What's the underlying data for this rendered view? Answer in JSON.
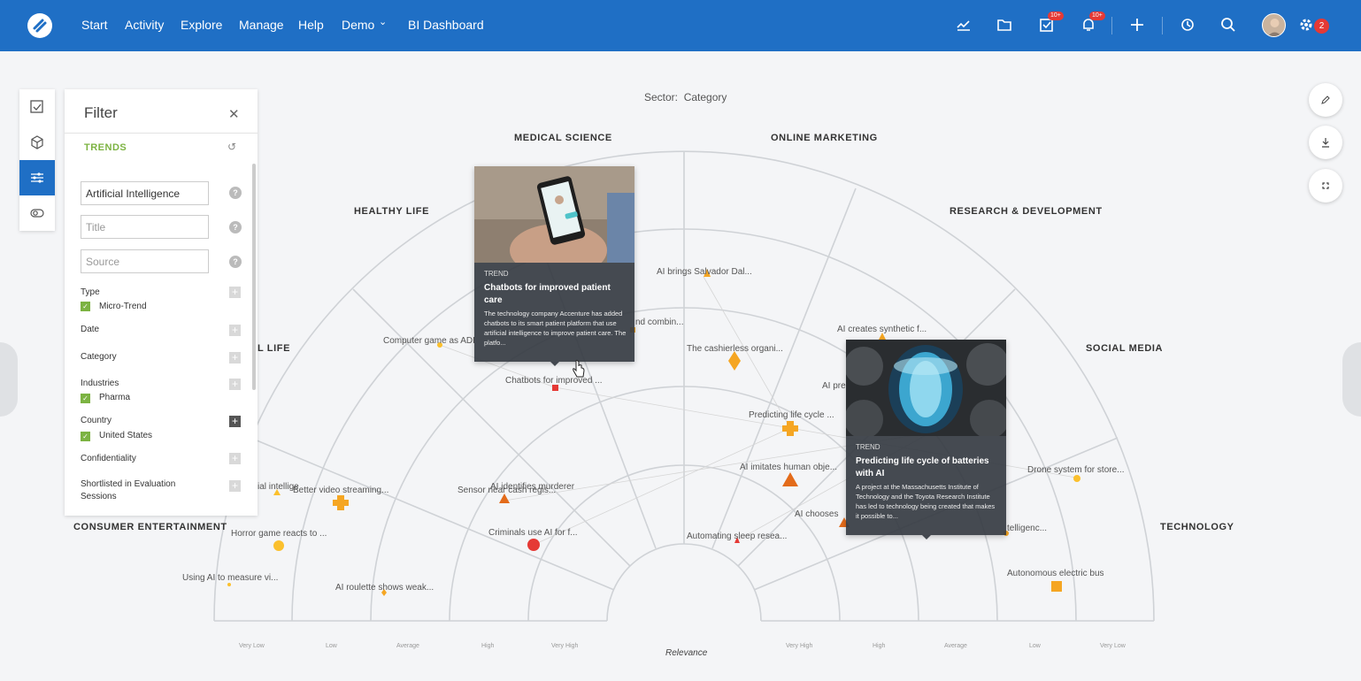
{
  "nav": {
    "items": [
      "Start",
      "Activity",
      "Explore",
      "Manage",
      "Help",
      "Demo",
      "BI Dashboard"
    ],
    "badges": {
      "tasks": "10+",
      "notifications": "10+",
      "settings": "2"
    }
  },
  "filter": {
    "title": "Filter",
    "section_label": "TRENDS",
    "fields": {
      "topic_value": "Artificial Intelligence",
      "title_placeholder": "Title",
      "source_placeholder": "Source"
    },
    "sections": {
      "type": "Type",
      "type_value": "Micro-Trend",
      "date": "Date",
      "category": "Category",
      "industries": "Industries",
      "industries_value": "Pharma",
      "country": "Country",
      "country_value": "United States",
      "confidentiality": "Confidentiality",
      "shortlisted_line1": "Shortlisted in Evaluation",
      "shortlisted_line2": "Sessions"
    },
    "help_glyph": "?"
  },
  "radar": {
    "sector_label": "Sector:",
    "sector_value": "Category",
    "relevance_label": "Relevance",
    "ring_labels_left": [
      "Very Low",
      "Low",
      "Average",
      "High",
      "Very High"
    ],
    "ring_labels_right": [
      "Very High",
      "High",
      "Average",
      "Low",
      "Very Low"
    ],
    "categories": {
      "consumer_entertainment": "CONSUMER ENTERTAINMENT",
      "digital_life": "L LIFE",
      "healthy_life": "HEALTHY LIFE",
      "medical_science": "MEDICAL SCIENCE",
      "online_marketing": "ONLINE MARKETING",
      "research_development": "RESEARCH & DEVELOPMENT",
      "social_media": "SOCIAL MEDIA",
      "technology": "TECHNOLOGY"
    },
    "trends": {
      "t1": "AI brings Salvador Dal...",
      "t2": "nd combin...",
      "t3": "AI creates synthetic f...",
      "t4": "Computer game as ADI",
      "t5": "The cashierless organi...",
      "t6": "AI pre",
      "t7": "Chatbots for improved ...",
      "t8": "Predicting life cycle ...",
      "t9": "AI imitates human obje...",
      "t10": "Drone system for store...",
      "t11": "ial intellige",
      "t12": "Better video streaming...",
      "t13": "Sensor near cash regis...",
      "t14": "AI identifies murderer",
      "t15": "AI chooses",
      "t16": "Horror game reacts to ...",
      "t17": "Criminals use AI for f...",
      "t18": "Automating sleep resea...",
      "t19": "telligenc...",
      "t20": "Using AI to measure vi...",
      "t21": "AI roulette shows weak...",
      "t22": "Autonomous electric bus"
    }
  },
  "cards": {
    "chatbots": {
      "type": "TREND",
      "title": "Chatbots for improved patient care",
      "desc": "The technology company Accenture has added chatbots to its smart patient platform that use artificial intelligence to improve patient care. The platfo..."
    },
    "batteries": {
      "type": "TREND",
      "title": "Predicting life cycle of batteries with AI",
      "desc": "A project at the Massachusetts Institute of Technology and the Toyota Research Institute has led to technology being created that makes it possible to..."
    }
  },
  "colors": {
    "brand": "#1f6fc5",
    "accent_green": "#7cb342",
    "marker_orange": "#f5a623",
    "marker_red": "#e53935",
    "marker_yellow": "#fbc02d"
  }
}
